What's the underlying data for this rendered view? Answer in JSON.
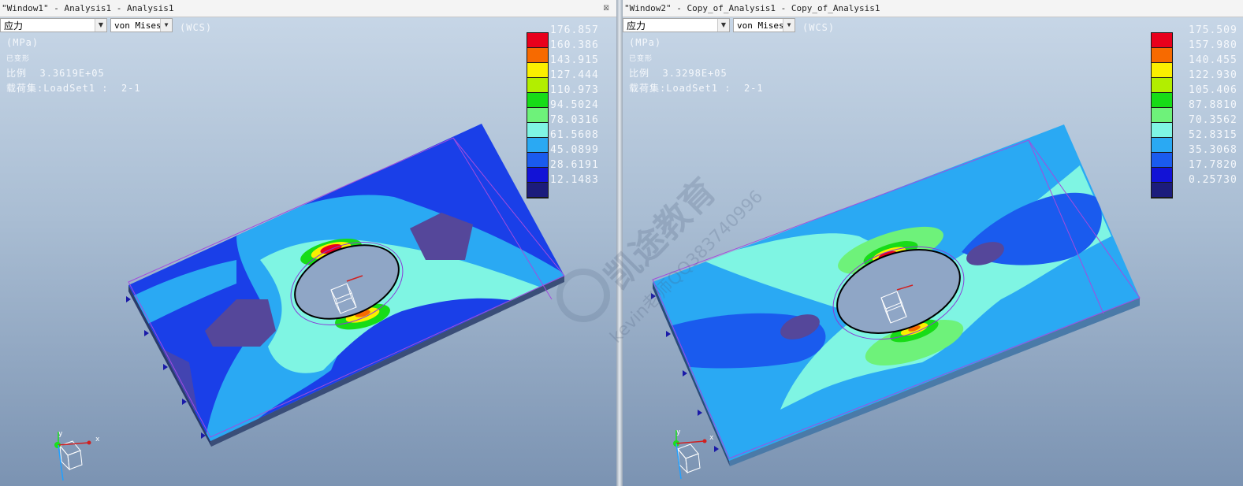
{
  "windows": [
    {
      "title": "\"Window1\" - Analysis1 - Analysis1",
      "quantity": "应力",
      "component": "von Mises",
      "coord": "(WCS)",
      "units": "(MPa)",
      "deformed": "已变形",
      "scale_label": "比例",
      "scale_value": "3.3619E+05",
      "loadset_label": "载荷集:LoadSet1 :",
      "loadset_value": "2-1",
      "legend_values": [
        "176.857",
        "160.386",
        "143.915",
        "127.444",
        "110.973",
        "94.5024",
        "78.0316",
        "61.5608",
        "45.0899",
        "28.6191",
        "12.1483"
      ]
    },
    {
      "title": "\"Window2\" - Copy_of_Analysis1 - Copy_of_Analysis1",
      "quantity": "应力",
      "component": "von Mises",
      "coord": "(WCS)",
      "units": "(MPa)",
      "deformed": "已变形",
      "scale_label": "比例",
      "scale_value": "3.3298E+05",
      "loadset_label": "载荷集:LoadSet1 :",
      "loadset_value": "2-1",
      "legend_values": [
        "175.509",
        "157.980",
        "140.455",
        "122.930",
        "105.406",
        "87.8810",
        "70.3562",
        "52.8315",
        "35.3068",
        "17.7820",
        "0.25730"
      ]
    }
  ],
  "legend_colors": [
    "#e8001c",
    "#f76a00",
    "#fbef00",
    "#b2ee00",
    "#17dc17",
    "#6ef27a",
    "#7ff5e3",
    "#2aa9f3",
    "#1a5bee",
    "#1212d6",
    "#1c1c7c"
  ],
  "axis_labels": {
    "x": "x",
    "y": "y"
  },
  "watermark": {
    "text": "凯途教育",
    "subtext": "kevin老师QQ383740996"
  }
}
